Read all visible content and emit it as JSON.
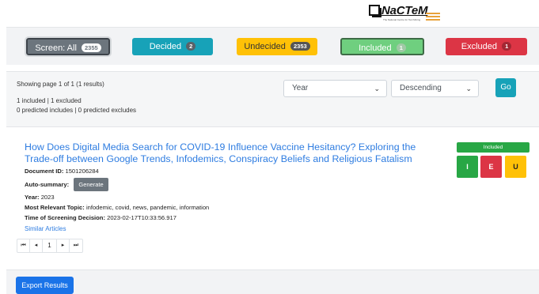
{
  "logo": {
    "name": "NaCTeM",
    "tagline": "The National Centre for Text Mining"
  },
  "filters": {
    "screen": {
      "label": "Screen: All",
      "count": "2355"
    },
    "decided": {
      "label": "Decided",
      "count": "2"
    },
    "undecided": {
      "label": "Undecided",
      "count": "2353"
    },
    "included": {
      "label": "Included",
      "count": "1"
    },
    "excluded": {
      "label": "Excluded",
      "count": "1"
    }
  },
  "results": {
    "showing": "Showing page 1 of 1 (1 results)",
    "summary": "1 included | 1 excluded",
    "predicted": "0 predicted includes | 0 predicted excludes",
    "sort_field": "Year",
    "sort_order": "Descending",
    "go_label": "Go"
  },
  "article": {
    "title": "How Does Digital Media Search for COVID-19 Influence Vaccine Hesitancy? Exploring the Trade-off between Google Trends, Infodemics, Conspiracy Beliefs and Religious Fatalism",
    "document_id_label": "Document ID:",
    "document_id": "1501206284",
    "auto_summary_label": "Auto-summary:",
    "generate_label": "Generate",
    "year_label": "Year:",
    "year": "2023",
    "topic_label": "Most Relevant Topic:",
    "topic": "infodemic, covid, news, pandemic, information",
    "time_label": "Time of Screening Decision:",
    "time": "2023-02-17T10:33:56.917",
    "similar_label": "Similar Articles",
    "status": "Included",
    "decision_buttons": {
      "include": "I",
      "exclude": "E",
      "undecide": "U"
    }
  },
  "pager": {
    "first": "⏮",
    "prev": "◂",
    "page": "1",
    "next": "▸",
    "last": "⏭"
  },
  "footer": {
    "export_label": "Export Results"
  },
  "colors": {
    "included": "#28a745",
    "excluded": "#dc3545",
    "undecided": "#ffc107",
    "decided": "#17a2b8",
    "link": "#2f7de1",
    "primary": "#1a73e8"
  }
}
